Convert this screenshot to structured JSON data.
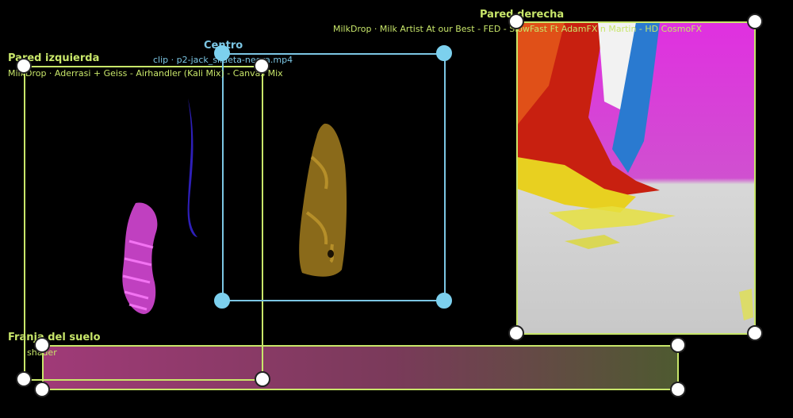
{
  "surfaces": {
    "left_wall": {
      "title": "Pared izquierda",
      "source": "MilkDrop · Aderrasi + Geiss - Airhandler (Kali Mix) - Canvas Mix"
    },
    "center": {
      "title": "Centro",
      "source": "clip · p2-jack_silueta-negra.mp4"
    },
    "right_wall": {
      "title": "Pared derecha",
      "source": "MilkDrop · Milk Artist At our Best - FED - SlowFast Ft AdamFX n Martin - HD CosmoFX"
    },
    "floor": {
      "title": "Franja del suelo",
      "source": "shader"
    }
  },
  "colors": {
    "lime": "#c8e66a",
    "cyan": "#7cc6e4",
    "handle": "#ffffff"
  }
}
